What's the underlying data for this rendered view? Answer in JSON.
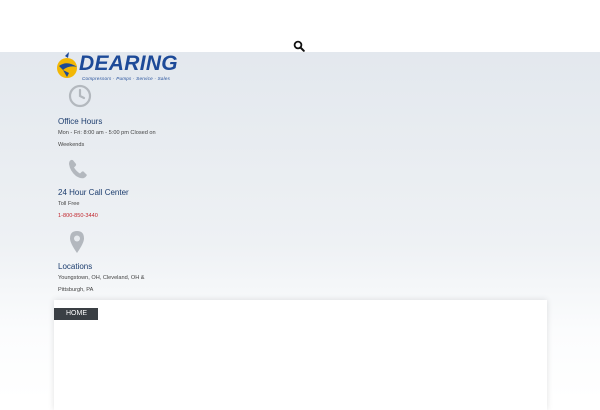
{
  "header": {
    "search_icon": "magnifier-icon"
  },
  "logo": {
    "wordmark": "DEARING",
    "tagline": "Compressors · Pumps · Service · Sales",
    "brand_color": "#1d4a98",
    "accent_color": "#f2b705"
  },
  "contact": {
    "office_hours": {
      "icon": "clock-icon",
      "title": "Office Hours",
      "text": "Mon - Fri: 8:00 am - 5:00 pm Closed on Weekends"
    },
    "call_center": {
      "icon": "phone-icon",
      "title": "24 Hour Call Center",
      "label": "Toll Free",
      "phone": "1-800-850-3440"
    },
    "locations": {
      "icon": "map-pin-icon",
      "title": "Locations",
      "text": "Youngstown, OH, Cleveland, OH & Pittsburgh, PA"
    }
  },
  "nav": {
    "home_label": "HOME"
  },
  "colors": {
    "icon_gray": "#b3b8be",
    "title_blue": "#1c3d6e",
    "phone_red": "#c1272d",
    "tab_dark": "#3a3f44"
  }
}
